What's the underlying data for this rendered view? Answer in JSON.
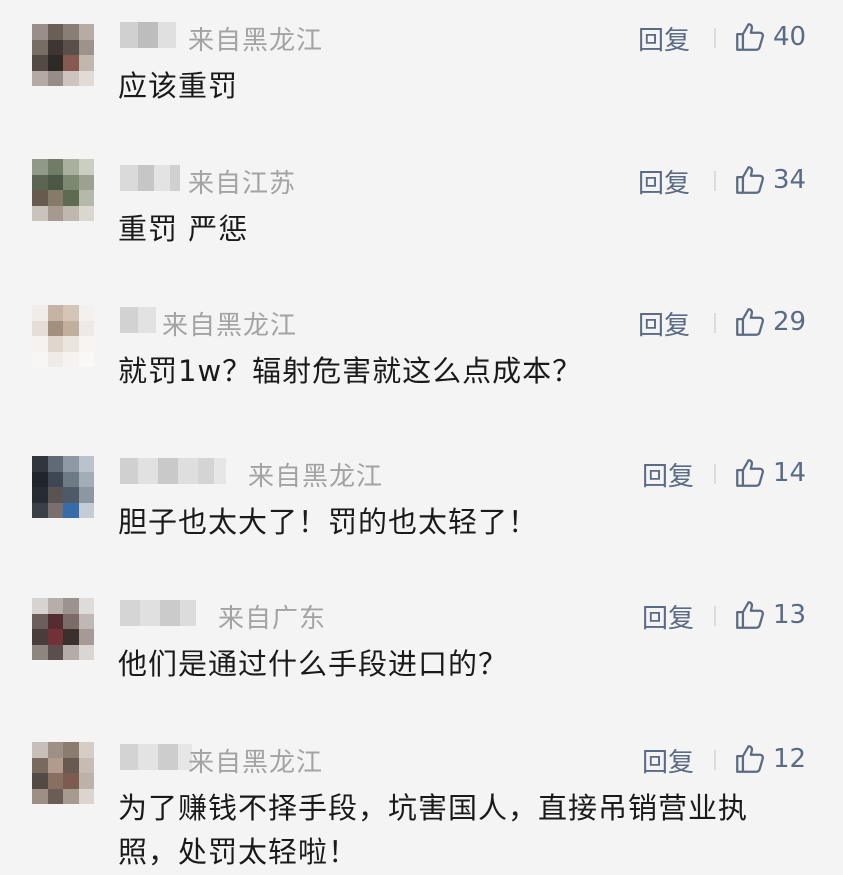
{
  "comments": [
    {
      "location": "来自黑龙江",
      "reply": "回复",
      "likes": "40",
      "text": "应该重罚"
    },
    {
      "location": "来自江苏",
      "reply": "回复",
      "likes": "34",
      "text": "重罚 严惩"
    },
    {
      "location": "来自黑龙江",
      "reply": "回复",
      "likes": "29",
      "text": "就罚1w？辐射危害就这么点成本？"
    },
    {
      "location": "来自黑龙江",
      "reply": "回复",
      "likes": "14",
      "text": "胆子也太大了！罚的也太轻了！"
    },
    {
      "location": "来自广东",
      "reply": "回复",
      "likes": "13",
      "text": "他们是通过什么手段进口的？"
    },
    {
      "location": "来自黑龙江",
      "reply": "回复",
      "likes": "12",
      "text": "为了赚钱不择手段，坑害国人，直接吊销营业执照，处罚太轻啦！"
    }
  ],
  "icons": {
    "like": "thumbs-up-icon",
    "avatar": "pixelated-avatar"
  },
  "colors": {
    "accent": "#5b6b85",
    "location": "#a3a3a3",
    "text": "#1a1a1a",
    "background": "#f4f4f4"
  }
}
